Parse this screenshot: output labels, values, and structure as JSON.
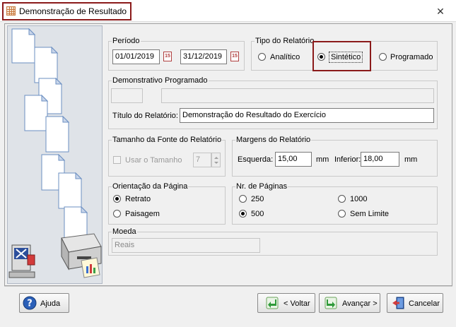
{
  "window": {
    "title": "Demonstração de Resultado",
    "close_glyph": "✕"
  },
  "periodo": {
    "label": "Período",
    "start": "01/01/2019",
    "end": "31/12/2019",
    "cal_glyph": "15"
  },
  "tipo": {
    "label": "Tipo do Relatório",
    "options": [
      "Analítico",
      "Sintético",
      "Programado"
    ],
    "selected": "Sintético"
  },
  "demonstrativo": {
    "label": "Demonstrativo Programado",
    "code": "",
    "name": "",
    "titulo_label": "Título do Relatório:",
    "titulo_value": "Demonstração do Resultado do Exercício"
  },
  "fonte": {
    "label": "Tamanho da Fonte do Relatório",
    "checkbox_label": "Usar o Tamanho",
    "checked": false,
    "size": "7"
  },
  "margens": {
    "label": "Margens do Relatório",
    "esquerda_label": "Esquerda:",
    "esquerda": "15,00",
    "inferior_label": "Inferior:",
    "inferior": "18,00",
    "unit": "mm"
  },
  "orientacao": {
    "label": "Orientação da Página",
    "options": [
      "Retrato",
      "Paisagem"
    ],
    "selected": "Retrato"
  },
  "paginas": {
    "label": "Nr. de Páginas",
    "options": [
      "250",
      "1000",
      "500",
      "Sem Limite"
    ],
    "selected": "500"
  },
  "moeda": {
    "label": "Moeda",
    "value": "Reais"
  },
  "buttons": {
    "ajuda": "Ajuda",
    "voltar": "< Voltar",
    "avancar": "Avançar >",
    "cancelar": "Cancelar"
  },
  "colors": {
    "accent_highlight": "#8b1a1a",
    "window_bg": "#f0f0f0",
    "side_panel": "#dfe3e8"
  }
}
